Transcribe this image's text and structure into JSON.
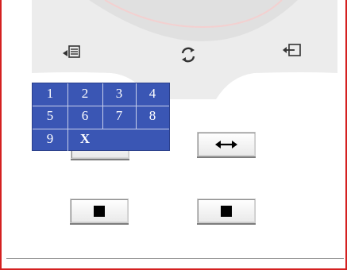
{
  "numpad": {
    "keys": [
      "1",
      "2",
      "3",
      "4",
      "5",
      "6",
      "7",
      "8",
      "9",
      "X"
    ]
  },
  "icons": {
    "left_button": "input-left-icon",
    "center_button": "refresh-icon",
    "right_button": "input-right-icon",
    "swap_button": "left-right-arrow-icon",
    "stop_button": "stop-square-icon"
  },
  "colors": {
    "frame_border": "#d42020",
    "numpad_bg": "#3a56b4",
    "pad_bg": "#ececec"
  }
}
